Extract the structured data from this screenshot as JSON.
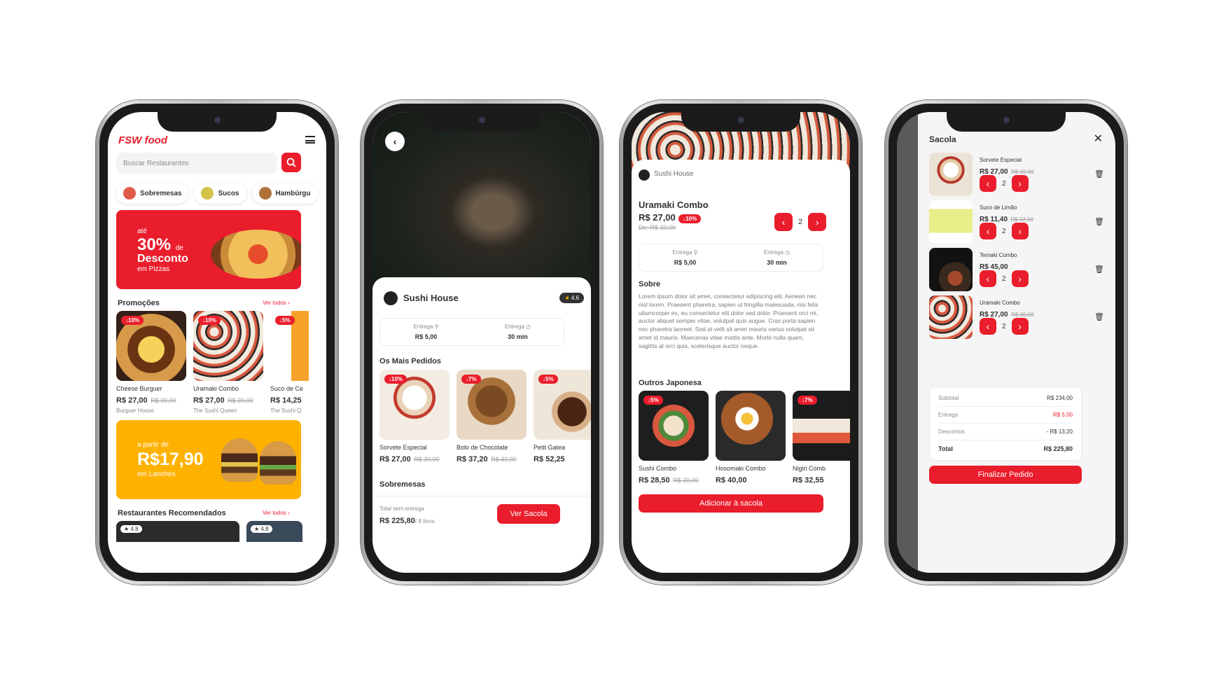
{
  "colors": {
    "accent": "#EA1D2C",
    "promo_yellow": "#FFB100",
    "text": "#323232"
  },
  "home": {
    "brand": "FSW food",
    "search_placeholder": "Buscar Restaurantes",
    "categories": [
      {
        "label": "Sobremesas"
      },
      {
        "label": "Sucos"
      },
      {
        "label": "Hambúrgu"
      }
    ],
    "banner1": {
      "pre": "até",
      "big": "30%",
      "de": "de",
      "mid": "Desconto",
      "post": "em Pizzas"
    },
    "promos_title": "Promoções",
    "see_all": "Ver todos",
    "products": [
      {
        "discount": "10%",
        "name": "Cheese Burguer",
        "price": "R$ 27,00",
        "old": "R$ 30,00",
        "rest": "Burguer House"
      },
      {
        "discount": "10%",
        "name": "Uramaki Combo",
        "price": "R$ 27,00",
        "old": "R$ 30,00",
        "rest": "The Sushi Queen"
      },
      {
        "discount": "5%",
        "name": "Suco de Ce",
        "price": "R$ 14,25",
        "old": "",
        "rest": "The Sushi Q"
      }
    ],
    "banner2": {
      "pre": "a partir de",
      "big": "R$17,90",
      "post": "em Lanches"
    },
    "recommended_title": "Restaurantes Recomendados",
    "ratings": [
      "4.8",
      "4.8"
    ]
  },
  "restaurant": {
    "name": "Sushi House",
    "rating": "4.6",
    "delivery_label": "Entrega",
    "delivery_value": "R$ 5,00",
    "time_label": "Entrega",
    "time_value": "30 min",
    "most_ordered": "Os Mais Pedidos",
    "products": [
      {
        "discount": "10%",
        "name": "Sorvete Especial",
        "price": "R$ 27,00",
        "old": "R$ 30,00"
      },
      {
        "discount": "7%",
        "name": "Bolo de Chocolate",
        "price": "R$ 37,20",
        "old": "R$ 40,00"
      },
      {
        "discount": "5%",
        "name": "Petit Gatea",
        "price": "R$ 52,25",
        "old": ""
      }
    ],
    "desserts": "Sobremesas",
    "total_label": "Total sem entrega",
    "total_value": "R$ 225,80",
    "items": "/ 8 itens",
    "bag_button": "Ver Sacola"
  },
  "product": {
    "restaurant": "Sushi House",
    "name": "Uramaki Combo",
    "price": "R$ 27,00",
    "discount": "10%",
    "old": "De: R$ 30,00",
    "qty": "2",
    "delivery_label": "Entrega",
    "delivery_value": "R$ 5,00",
    "time_label": "Entrega",
    "time_value": "30 min",
    "about_title": "Sobre",
    "about_text": "Lorem ipsum dolor sit amet, consectetur adipiscing elit. Aenean nec nisl lorem. Praesent pharetra, sapien ut fringilla malesuada, nisi felis ullamcorper ex, eu consectetur elit dolor sed dolor. Praesent orci mi, auctor aliquet semper vitae, volutpat quis augue. Cras porta sapien nec pharetra laoreet. Sed at velit sit amet mauris varius volutpat sit amet id mauris. Maecenas vitae mattis ante. Morbi nulla quam, sagittis at orci quis, scelerisque auctor neque.",
    "others_title": "Outros Japonesa",
    "others": [
      {
        "discount": "5%",
        "name": "Sushi Combo",
        "price": "R$ 28,50",
        "old": "R$ 30,00"
      },
      {
        "discount": "",
        "name": "Hosomaki Combo",
        "price": "R$ 40,00",
        "old": ""
      },
      {
        "discount": "7%",
        "name": "Nigiri Comb",
        "price": "R$ 32,55",
        "old": ""
      }
    ],
    "add_button": "Adicionar à sacola"
  },
  "bag": {
    "title": "Sacola",
    "items": [
      {
        "name": "Sorvete Especial",
        "price": "R$ 27,00",
        "old": "R$ 30,00",
        "qty": "2"
      },
      {
        "name": "Suco de Limão",
        "price": "R$ 11,40",
        "old": "R$ 12,00",
        "qty": "2"
      },
      {
        "name": "Temaki Combo",
        "price": "R$ 45,00",
        "old": "",
        "qty": "2"
      },
      {
        "name": "Uramaki Combo",
        "price": "R$ 27,00",
        "old": "R$ 30,00",
        "qty": "2"
      }
    ],
    "subtotal_label": "Subtotal",
    "subtotal": "R$ 234,00",
    "delivery_label": "Entrega",
    "delivery": "R$ 5,00",
    "discounts_label": "Descontos",
    "discounts": "- R$ 13,20",
    "total_label": "Total",
    "total": "R$ 225,80",
    "finish_button": "Finalizar Pedido"
  }
}
